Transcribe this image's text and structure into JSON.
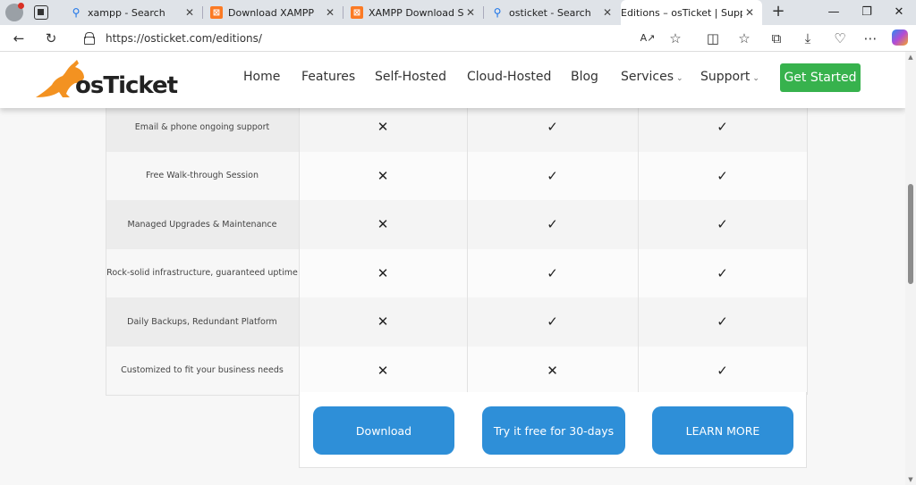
{
  "browser": {
    "tabs": [
      {
        "title": "xampp - Search",
        "favicon": "search-icon"
      },
      {
        "title": "Download XAMPP",
        "favicon": "xampp-icon"
      },
      {
        "title": "XAMPP Download Success",
        "favicon": "xampp-icon"
      },
      {
        "title": "osticket - Search",
        "favicon": "search-icon"
      },
      {
        "title": "Editions – osTicket | Support",
        "favicon": "page-icon"
      }
    ],
    "url": "https://osticket.com/editions/"
  },
  "site": {
    "logo": "osTicket",
    "nav": [
      {
        "label": "Home"
      },
      {
        "label": "Features"
      },
      {
        "label": "Self-Hosted"
      },
      {
        "label": "Cloud-Hosted"
      },
      {
        "label": "Blog"
      },
      {
        "label": "Services",
        "dropdown": true
      },
      {
        "label": "Support",
        "dropdown": true
      }
    ],
    "cta": "Get Started",
    "accent": "#37b24d",
    "button_color": "#2e8fd8"
  },
  "comparison": {
    "rows": [
      {
        "feature": "Email & phone ongoing support",
        "values": [
          "✕",
          "✓",
          "✓"
        ]
      },
      {
        "feature": "Free Walk-through Session",
        "values": [
          "✕",
          "✓",
          "✓"
        ]
      },
      {
        "feature": "Managed Upgrades & Maintenance",
        "values": [
          "✕",
          "✓",
          "✓"
        ]
      },
      {
        "feature": "Rock-solid infrastructure, guaranteed uptime",
        "values": [
          "✕",
          "✓",
          "✓"
        ]
      },
      {
        "feature": "Daily Backups, Redundant Platform",
        "values": [
          "✕",
          "✓",
          "✓"
        ]
      },
      {
        "feature": "Customized to fit your business needs",
        "values": [
          "✕",
          "✕",
          "✓"
        ]
      }
    ],
    "buttons": [
      "Download",
      "Try it free for 30-days",
      "LEARN MORE"
    ]
  }
}
